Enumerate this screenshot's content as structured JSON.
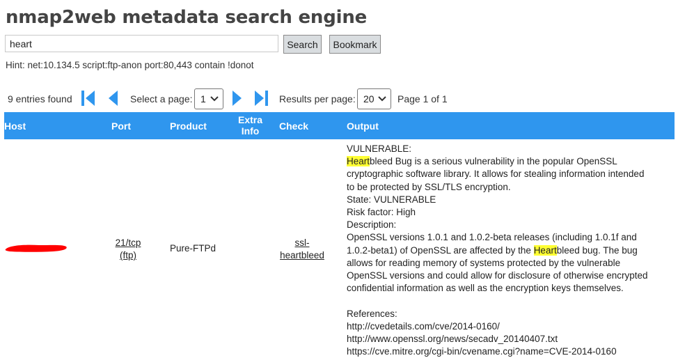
{
  "app": {
    "title": "nmap2web metadata search engine"
  },
  "search": {
    "value": "heart",
    "search_label": "Search",
    "bookmark_label": "Bookmark"
  },
  "hint": "Hint: net:10.134.5 script:ftp-anon port:80,443 contain !donot",
  "pager": {
    "entries_found": "9 entries found",
    "select_page_label": "Select a page:",
    "page_value": "1",
    "results_per_page_label": "Results per page:",
    "results_per_page_value": "20",
    "page_of": "Page 1 of 1",
    "icons": [
      "first-page-icon",
      "previous-page-icon",
      "next-page-icon",
      "last-page-icon"
    ]
  },
  "colors": {
    "header_bg": "#2f96ee",
    "highlight": "#ffff33",
    "redaction": "#ff0000",
    "nav_icon": "#2f96ee"
  },
  "table": {
    "headers": {
      "host": "Host",
      "port": "Port",
      "product": "Product",
      "extra_line1": "Extra",
      "extra_line2": "Info",
      "check": "Check",
      "output": "Output"
    },
    "rows": [
      {
        "host": "",
        "port_line1": "21/tcp",
        "port_line2": "(ftp)",
        "product": "Pure-FTPd",
        "check_line1": "ssl-",
        "check_line2": "heartbleed",
        "output": {
          "l1": "VULNERABLE:",
          "l2_hl": "Heart",
          "l2_rest": "bleed Bug is a serious vulnerability in the popular OpenSSL",
          "l3": "cryptographic software library. It allows for stealing information intended",
          "l4": "to be protected by SSL/TLS encryption.",
          "l5": "State: VULNERABLE",
          "l6": "Risk factor: High",
          "l7": "Description:",
          "l8": "OpenSSL versions 1.0.1 and 1.0.2-beta releases (including 1.0.1f and",
          "l9_pre": "1.0.2-beta1) of OpenSSL are affected by the ",
          "l9_hl": "Heart",
          "l9_post": "bleed bug. The bug",
          "l10": "allows for reading memory of systems protected by the vulnerable",
          "l11": "OpenSSL versions and could allow for disclosure of otherwise encrypted",
          "l12": "confidential information as well as the encryption keys themselves.",
          "l13": "References:",
          "l14": "http://cvedetails.com/cve/2014-0160/",
          "l15": "http://www.openssl.org/news/secadv_20140407.txt",
          "l16": "https://cve.mitre.org/cgi-bin/cvename.cgi?name=CVE-2014-0160"
        }
      }
    ]
  }
}
